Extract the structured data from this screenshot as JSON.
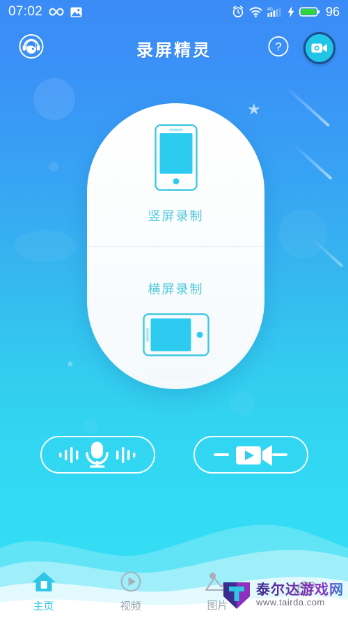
{
  "status_bar": {
    "time": "07:02",
    "battery_level": "96",
    "network_type": "4G",
    "icons": [
      "infinity-icon",
      "image-icon",
      "alarm-clock-icon",
      "wifi-icon",
      "cellular-signal-icon",
      "charging-bolt-icon",
      "battery-icon"
    ]
  },
  "app_bar": {
    "title": "录屏精灵",
    "avatar_icon": "user-headphones-icon",
    "help_icon": "question-mark-icon",
    "record_icon": "video-camera-icon"
  },
  "card": {
    "portrait": {
      "label": "竖屏录制",
      "icon": "phone-portrait-icon"
    },
    "landscape": {
      "label": "横屏录制",
      "icon": "phone-landscape-icon"
    }
  },
  "quick_actions": [
    {
      "name": "audio-record-button",
      "icon": "microphone-icon"
    },
    {
      "name": "video-record-button",
      "icon": "video-camera-play-icon"
    }
  ],
  "bottom_nav": [
    {
      "label": "主页",
      "icon": "home-icon",
      "active": true
    },
    {
      "label": "视频",
      "icon": "play-circle-icon",
      "active": false
    },
    {
      "label": "图片",
      "icon": "image-mountain-icon",
      "active": false
    },
    {
      "label": "",
      "icon": "planet-explore-icon",
      "active": false
    }
  ],
  "watermark": {
    "name_cn": "泰尔达游戏网",
    "url": "www.tairda.com"
  },
  "colors": {
    "bg_top": "#3B8BF6",
    "bg_bottom": "#35DFF5",
    "accent_cyan": "#2FC6E6",
    "label_teal": "#4FC9DC",
    "nav_inactive": "#9aa3ab",
    "battery_green": "#2DD636"
  }
}
